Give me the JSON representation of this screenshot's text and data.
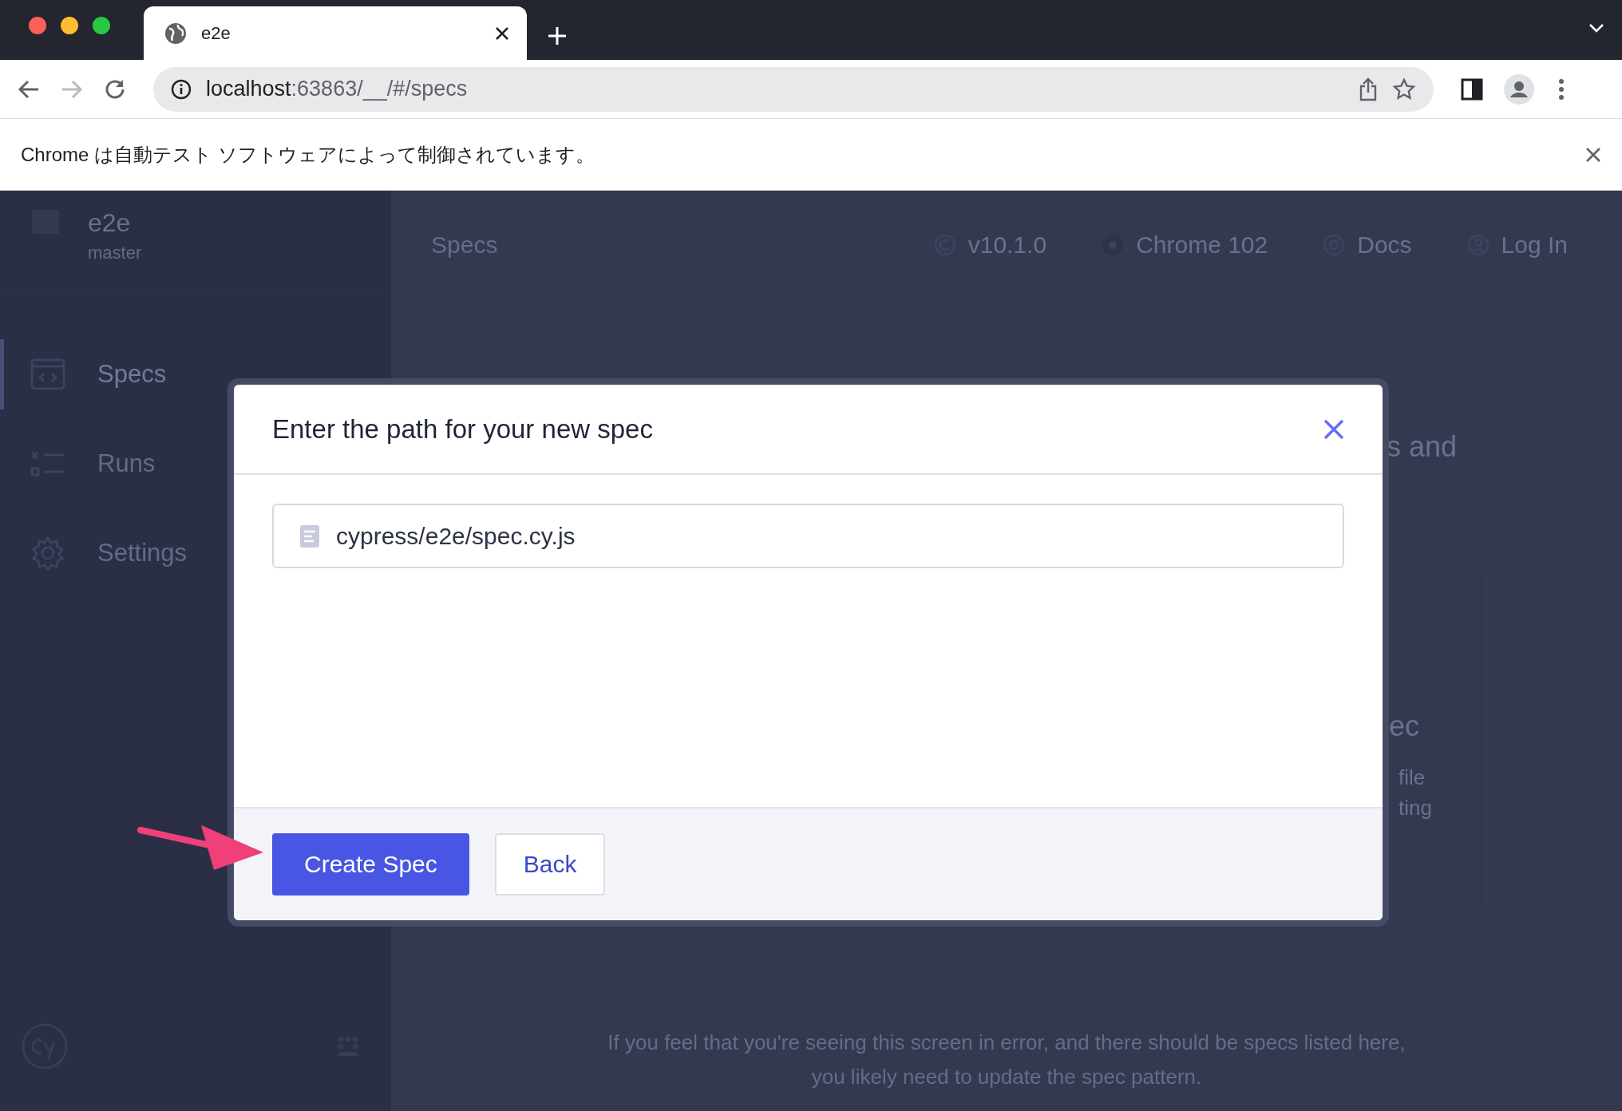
{
  "browser": {
    "tab_title": "e2e",
    "url_host": "localhost",
    "url_rest": ":63863/__/#/specs",
    "infobar": "Chrome は自動テスト ソフトウェアによって制御されています。"
  },
  "sidebar": {
    "project": "e2e",
    "branch": "master",
    "items": [
      {
        "label": "Specs",
        "selected": true
      },
      {
        "label": "Runs",
        "selected": false
      },
      {
        "label": "Settings",
        "selected": false
      }
    ]
  },
  "header": {
    "title": "Specs",
    "items": [
      {
        "label": "v10.1.0"
      },
      {
        "label": "Chrome 102"
      },
      {
        "label": "Docs"
      },
      {
        "label": "Log In"
      }
    ]
  },
  "background_fragments": [
    "s and",
    "ec",
    "file",
    "ting"
  ],
  "footer_note": [
    "If you feel that you're seeing this screen in error, and there should be specs listed here,",
    "you likely need to update the spec pattern."
  ],
  "modal": {
    "title": "Enter the path for your new spec",
    "path": "cypress/e2e/spec.cy.js",
    "primary_button": "Create Spec",
    "secondary_button": "Back"
  }
}
